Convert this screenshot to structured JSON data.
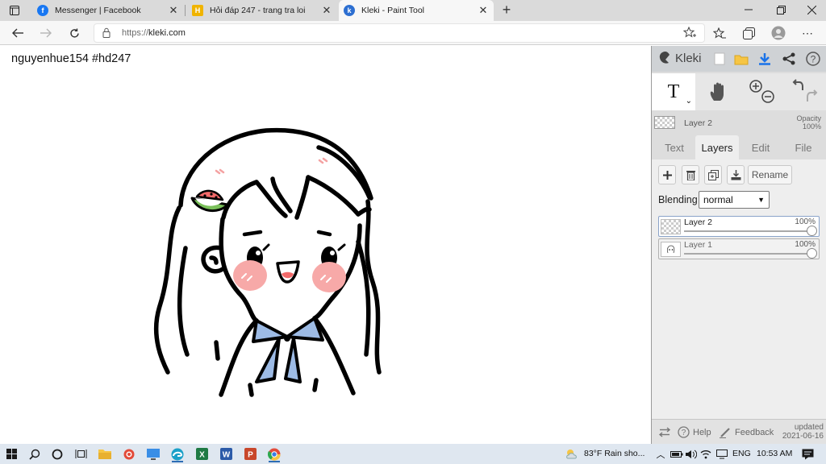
{
  "browser": {
    "tabs": [
      {
        "title": "Messenger | Facebook",
        "icon": "facebook-icon",
        "active": false
      },
      {
        "title": "Hỏi đáp 247 - trang tra loi",
        "icon": "hoidap-icon",
        "active": false
      },
      {
        "title": "Kleki - Paint Tool",
        "icon": "kleki-icon",
        "active": true
      }
    ],
    "url_protocol": "https://",
    "url_host": "kleki.com"
  },
  "canvas": {
    "signature": "nguyenhue154 #hd247"
  },
  "sidebar": {
    "logo_text": "Kleki",
    "current_layer": {
      "name": "Layer 2",
      "opacity_label": "Opacity",
      "opacity_value": "100%"
    },
    "tabs": [
      "Text",
      "Layers",
      "Edit",
      "File"
    ],
    "active_tab": "Layers",
    "rename_label": "Rename",
    "blending_label": "Blending",
    "blending_value": "normal",
    "layers": [
      {
        "name": "Layer 2",
        "opacity": "100%",
        "active": true
      },
      {
        "name": "Layer 1",
        "opacity": "100%",
        "active": false
      }
    ],
    "bottom": {
      "help": "Help",
      "feedback": "Feedback",
      "updated_label": "updated",
      "updated_date": "2021-06-16"
    }
  },
  "taskbar": {
    "weather": "83°F  Rain sho...",
    "language": "ENG",
    "time": "10:53 AM"
  },
  "colors": {
    "accent": "#1a73e8",
    "blush": "#f7a9a8",
    "collar": "#9dbbe5",
    "watermelon_green": "#7ac05a",
    "watermelon_red": "#f26a6a"
  }
}
